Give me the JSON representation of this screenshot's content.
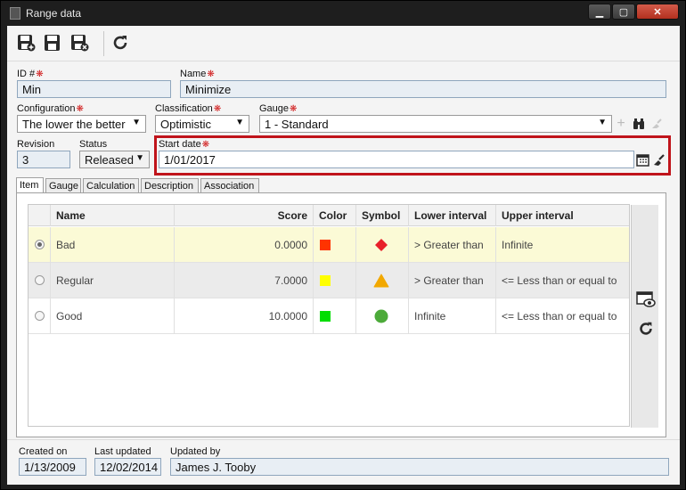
{
  "window": {
    "title": "Range data"
  },
  "toolbar": {
    "save_new": "save-new",
    "save": "save",
    "save_close": "save-close",
    "refresh": "refresh"
  },
  "form": {
    "id_label": "ID #",
    "id_value": "Min",
    "name_label": "Name",
    "name_value": "Minimize",
    "configuration_label": "Configuration",
    "configuration_value": "The lower the better",
    "classification_label": "Classification",
    "classification_value": "Optimistic",
    "gauge_label": "Gauge",
    "gauge_value": "1 - Standard",
    "revision_label": "Revision",
    "revision_value": "3",
    "status_label": "Status",
    "status_value": "Released",
    "start_date_label": "Start date",
    "start_date_value": "1/01/2017"
  },
  "tabs": [
    "Item",
    "Gauge",
    "Calculation",
    "Description",
    "Association"
  ],
  "table": {
    "headers": {
      "name": "Name",
      "score": "Score",
      "color": "Color",
      "symbol": "Symbol",
      "lower": "Lower interval",
      "upper": "Upper interval"
    },
    "rows": [
      {
        "name": "Bad",
        "score": "0.0000",
        "color": "#ff3300",
        "symbol": "red-diamond",
        "lower": "> Greater than",
        "upper": "Infinite"
      },
      {
        "name": "Regular",
        "score": "7.0000",
        "color": "#ffff00",
        "symbol": "yellow-triangle",
        "lower": "> Greater than",
        "upper": "<= Less than or equal to"
      },
      {
        "name": "Good",
        "score": "10.0000",
        "color": "#00dd00",
        "symbol": "green-circle",
        "lower": "Infinite",
        "upper": "<= Less than or equal to"
      }
    ]
  },
  "footer": {
    "created_label": "Created on",
    "created_value": "1/13/2009",
    "updated_label": "Last updated",
    "updated_value": "12/02/2014",
    "by_label": "Updated by",
    "by_value": "James J. Tooby"
  }
}
